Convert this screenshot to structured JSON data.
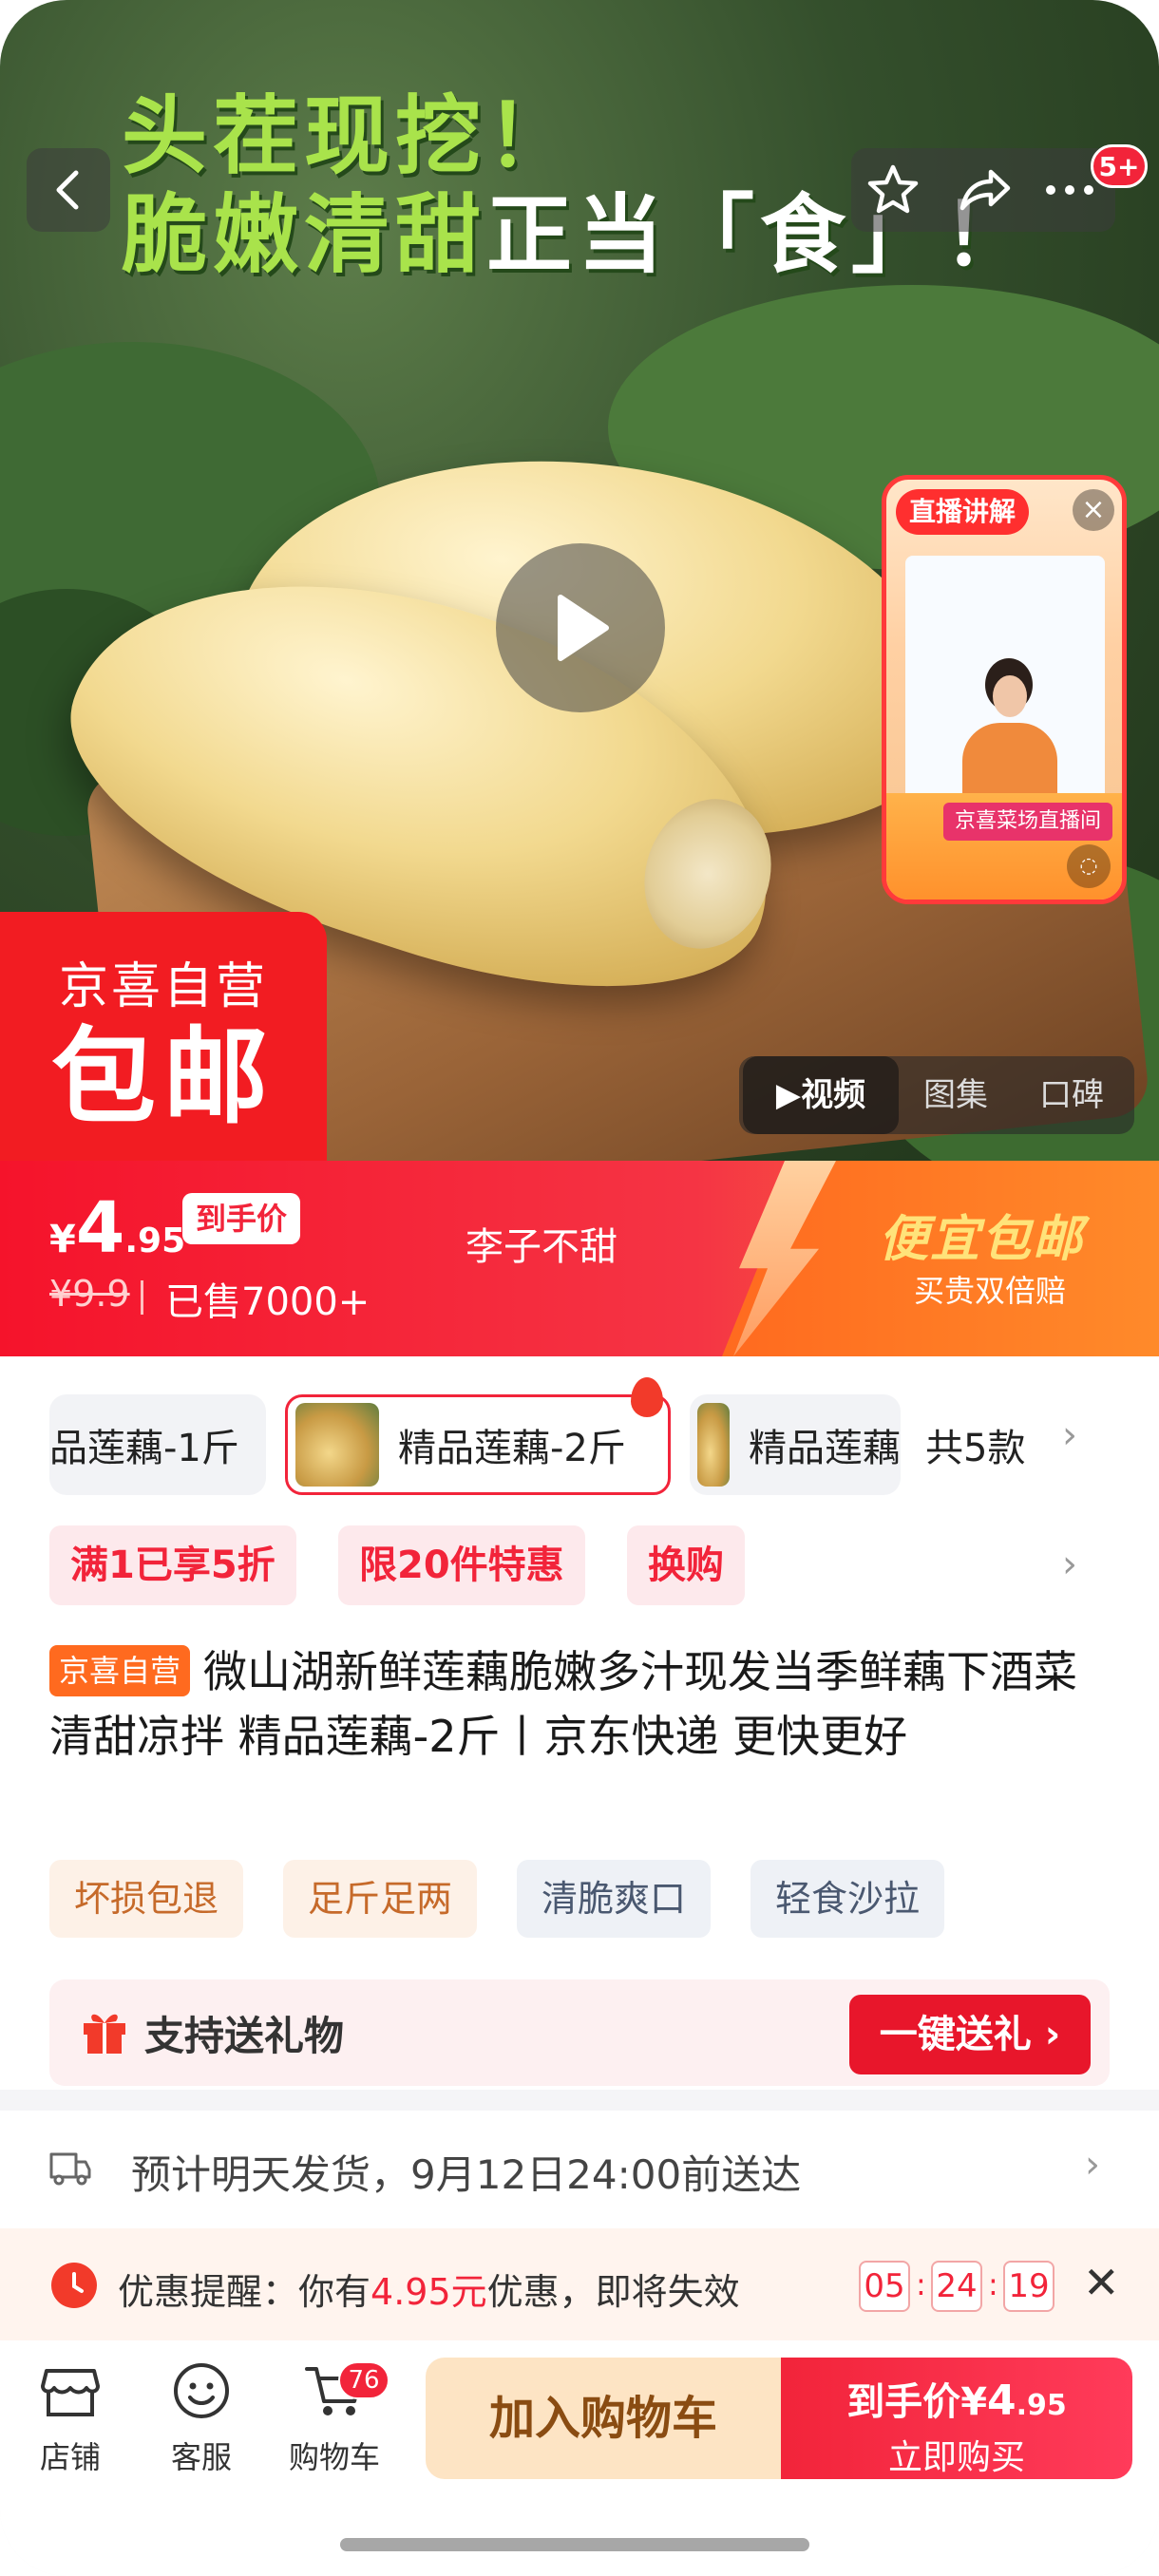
{
  "hero": {
    "headline_line1": "头茬现挖！",
    "headline_line2_green": "脆嫩清甜",
    "headline_line2_white": "正当「食」！",
    "notification_count": "5+",
    "badge_line1": "京喜自营",
    "badge_line2": "包邮",
    "live": {
      "tag": "直播讲解",
      "close": "×",
      "banner": "京喜菜场直播间"
    },
    "media_tabs": [
      "视频",
      "图集",
      "口碑"
    ]
  },
  "price_bar": {
    "currency": "¥",
    "price_int": "4",
    "price_dec": ".95",
    "price_tag": "到手价",
    "original_price": "¥9.9",
    "sold": "已售7000+",
    "shop": "李子不甜",
    "promo_title": "便宜包邮",
    "promo_sub": "买贵双倍赔"
  },
  "sku": {
    "items": [
      "品莲藕-1斤",
      "精品莲藕-2斤",
      "精品莲藕"
    ],
    "count": "共5款"
  },
  "promo_tags": [
    "满1已享5折",
    "限20件特惠",
    "换购"
  ],
  "product": {
    "badge": "京喜自营",
    "title": "微山湖新鲜莲藕脆嫩多汁现发当季鲜藕下酒菜 清甜凉拌 精品莲藕-2斤丨京东快递 更快更好"
  },
  "features": [
    "坏损包退",
    "足斤足两",
    "清脆爽口",
    "轻食沙拉"
  ],
  "gift": {
    "label": "支持送礼物",
    "button": "一键送礼 ›"
  },
  "delivery": {
    "text": "预计明天发货，9月12日24:00前送达"
  },
  "reminder": {
    "prefix": "优惠提醒：你有",
    "amount": "4.95元",
    "suffix": "优惠，即将失效",
    "hours": "05",
    "minutes": "24",
    "seconds": "19",
    "close": "✕"
  },
  "bottom_nav": {
    "store": "店铺",
    "service": "客服",
    "cart": "购物车",
    "cart_count": "76",
    "add_to_cart": "加入购物车",
    "buy_label": "到手价",
    "buy_currency": "¥",
    "buy_int": "4",
    "buy_dec": ".95",
    "buy_now": "立即购买"
  },
  "colors": {
    "brand_red": "#f2243a",
    "promo_orange": "#ff7a2a",
    "headline_green": "#a9e34b"
  }
}
